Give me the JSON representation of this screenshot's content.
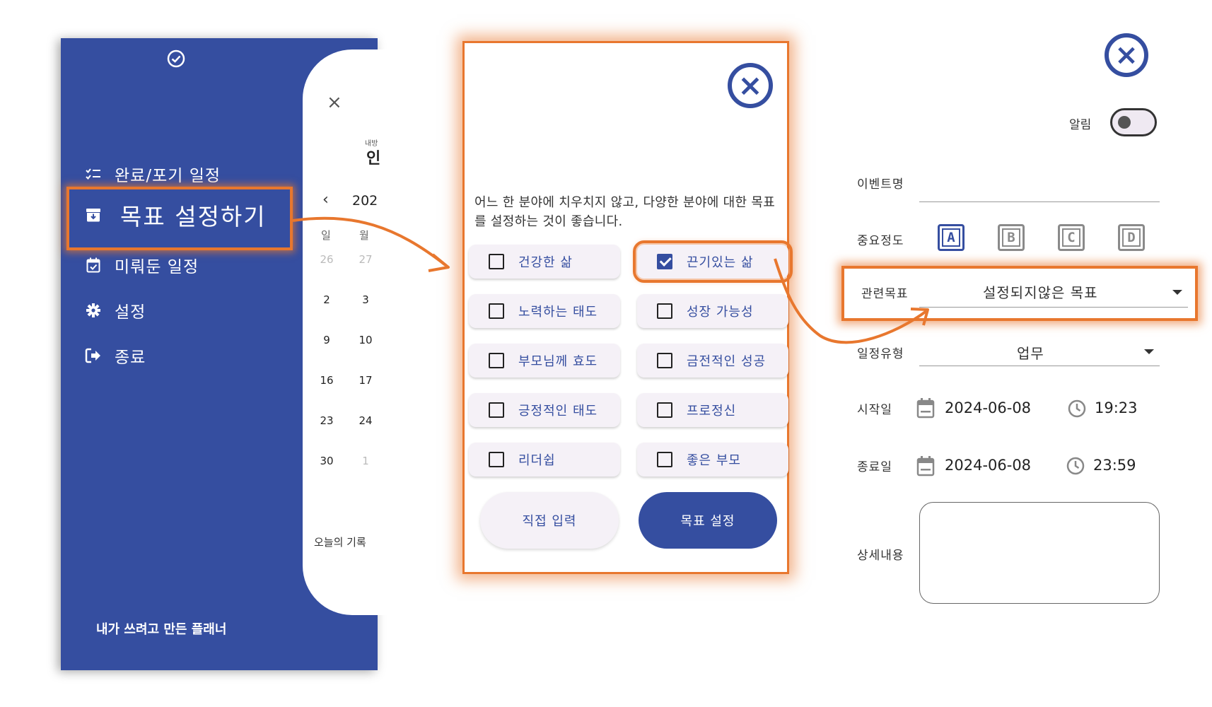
{
  "drawer": {
    "menu": [
      {
        "label": "완료/포기 일정",
        "icon": "checklist-icon"
      },
      {
        "label": "목표 설정하기",
        "icon": "archive-box-icon"
      },
      {
        "label": "미뤄둔 일정",
        "icon": "calendar-check-icon"
      },
      {
        "label": "설정",
        "icon": "gear-icon"
      },
      {
        "label": "종료",
        "icon": "sign-out-icon"
      }
    ],
    "footer": "내가 쓰려고 만든 플래너",
    "accent": "#354ea0"
  },
  "calendar_bg": {
    "close": "×",
    "hint_small": "내방",
    "hint_big": "인",
    "prev": "‹",
    "year": "202",
    "dow": [
      "일",
      "월"
    ],
    "rows": [
      [
        "26",
        "27"
      ],
      [
        "2",
        "3"
      ],
      [
        "9",
        "10"
      ],
      [
        "16",
        "17"
      ],
      [
        "23",
        "24"
      ],
      [
        "30",
        "1"
      ]
    ],
    "today_label": "오늘의 기록"
  },
  "goal_dialog": {
    "description": "어느 한 분야에 치우치지 않고, 다양한 분야에 대한 목표를 설정하는 것이 좋습니다.",
    "goals": [
      {
        "label": "건강한 삶",
        "checked": false
      },
      {
        "label": "끈기있는 삶",
        "checked": true
      },
      {
        "label": "노력하는 태도",
        "checked": false
      },
      {
        "label": "성장 가능성",
        "checked": false
      },
      {
        "label": "부모님께 효도",
        "checked": false
      },
      {
        "label": "금전적인 성공",
        "checked": false
      },
      {
        "label": "긍정적인 태도",
        "checked": false
      },
      {
        "label": "프로정신",
        "checked": false
      },
      {
        "label": "리더쉽",
        "checked": false
      },
      {
        "label": "좋은 부모",
        "checked": false
      }
    ],
    "direct_input_label": "직접 입력",
    "set_goal_label": "목표 설정"
  },
  "event_form": {
    "alarm_label": "알림",
    "alarm_on": false,
    "event_name_label": "이벤트명",
    "event_name_value": "",
    "importance_label": "중요정도",
    "importance_options": [
      "A",
      "B",
      "C",
      "D"
    ],
    "importance_selected": "A",
    "related_goal_label": "관련목표",
    "related_goal_value": "설정되지않은 목표",
    "schedule_type_label": "일정유형",
    "schedule_type_value": "업무",
    "start_label": "시작일",
    "start_date": "2024-06-08",
    "start_time": "19:23",
    "end_label": "종료일",
    "end_date": "2024-06-08",
    "end_time": "23:59",
    "detail_label": "상세내용",
    "detail_value": ""
  },
  "colors": {
    "primary": "#354ea0",
    "highlight": "#e8772e"
  }
}
